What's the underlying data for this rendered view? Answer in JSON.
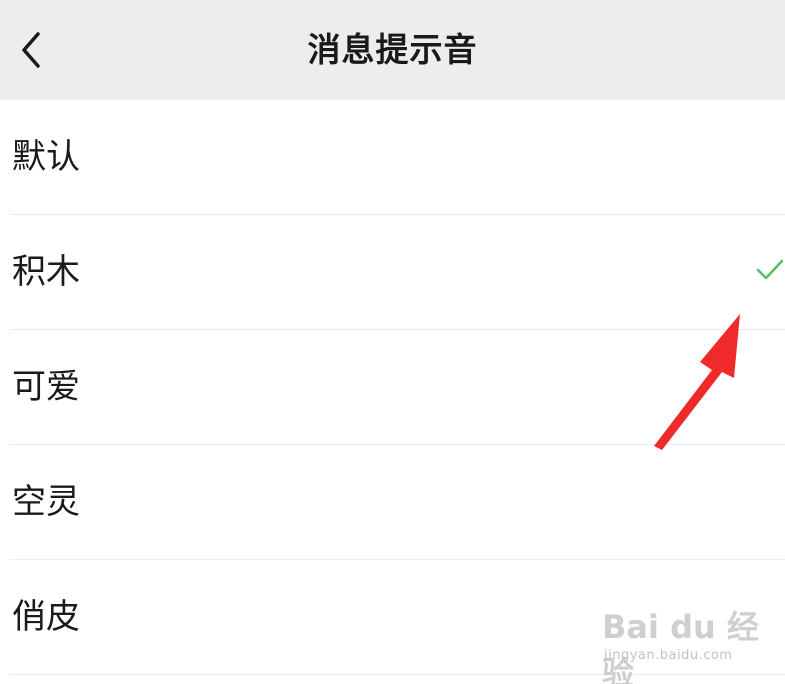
{
  "header": {
    "title": "消息提示音",
    "back_icon": "chevron-left-icon"
  },
  "sounds": [
    {
      "label": "默认",
      "selected": false
    },
    {
      "label": "积木",
      "selected": true
    },
    {
      "label": "可爱",
      "selected": false
    },
    {
      "label": "空灵",
      "selected": false
    },
    {
      "label": "俏皮",
      "selected": false
    }
  ],
  "annotation": {
    "arrow_color": "#f02a2a"
  },
  "watermark": {
    "logo": "Bai du 经验",
    "url": "jingyan.baidu.com"
  },
  "colors": {
    "header_bg": "#ededed",
    "check": "#4fbf6c"
  }
}
